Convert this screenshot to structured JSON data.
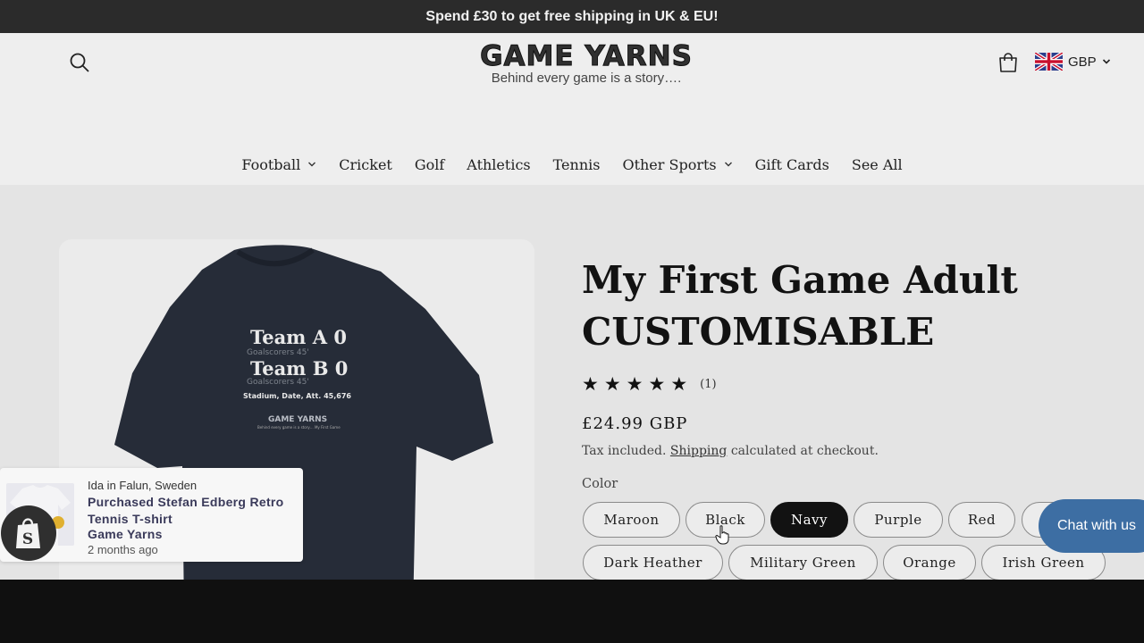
{
  "announcement": "Spend £30 to get free shipping in UK & EU!",
  "header": {
    "logo_title": "GAME YARNS",
    "logo_tagline": "Behind every game is a story….",
    "currency": "GBP"
  },
  "nav": {
    "items": [
      {
        "label": "Football",
        "dropdown": true
      },
      {
        "label": "Cricket",
        "dropdown": false
      },
      {
        "label": "Golf",
        "dropdown": false
      },
      {
        "label": "Athletics",
        "dropdown": false
      },
      {
        "label": "Tennis",
        "dropdown": false
      },
      {
        "label": "Other Sports",
        "dropdown": true
      },
      {
        "label": "Gift Cards",
        "dropdown": false
      },
      {
        "label": "See All",
        "dropdown": false
      }
    ]
  },
  "shirt": {
    "line1": "Team A 0",
    "sub1": "Goalscorers 45'",
    "line2": "Team B 0",
    "sub2": "Goalscorers 45'",
    "venue": "Stadium, Date, Att. 45,676",
    "brand": "GAME YARNS",
    "brand_tag": "Behind every game is a story… My First Game",
    "color": "#262c38"
  },
  "product": {
    "title": "My First Game Adult CUSTOMISABLE",
    "rating": 5,
    "review_count": "(1)",
    "price": "£24.99 GBP",
    "tax_before": "Tax included.",
    "shipping_link": "Shipping",
    "tax_after": "calculated at checkout.",
    "color_label": "Color",
    "colors": [
      "Maroon",
      "Black",
      "Navy",
      "Purple",
      "Red",
      "",
      "Dark Heather",
      "Military Green",
      "Orange",
      "Irish Green"
    ],
    "selected_color": "Navy"
  },
  "chat": {
    "label": "Chat with us"
  },
  "toast": {
    "location": "Ida in Falun, Sweden",
    "product": "Purchased Stefan Edberg Retro Tennis T-shirt",
    "store": "Game Yarns",
    "time": "2 months ago"
  }
}
